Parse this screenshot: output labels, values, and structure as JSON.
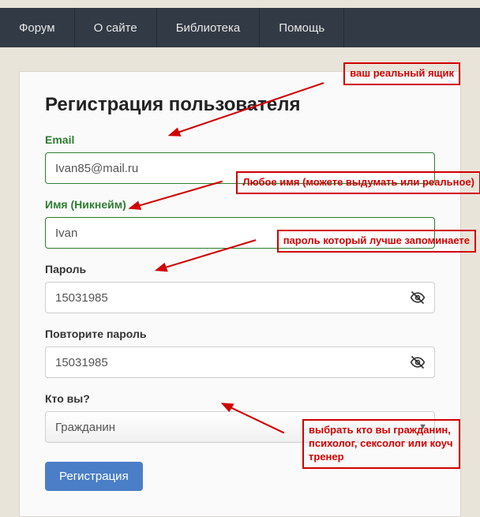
{
  "nav": {
    "items": [
      "Форум",
      "О сайте",
      "Библиотека",
      "Помощь"
    ]
  },
  "form": {
    "title": "Регистрация пользователя",
    "email_label": "Email",
    "email_value": "Ivan85@mail.ru",
    "name_label": "Имя (Никнейм)",
    "name_value": "Ivan",
    "password_label": "Пароль",
    "password_value": "15031985",
    "password2_label": "Повторите пароль",
    "password2_value": "15031985",
    "role_label": "Кто вы?",
    "role_value": "Гражданин",
    "submit_label": "Регистрация"
  },
  "annotations": {
    "email": "ваш реальный ящик",
    "name": "Любое имя (можете выдумать или реальное)",
    "password": "пароль который лучше запоминаете",
    "role": "выбрать кто вы гражданин, психолог, сексолог или коуч тренер"
  }
}
